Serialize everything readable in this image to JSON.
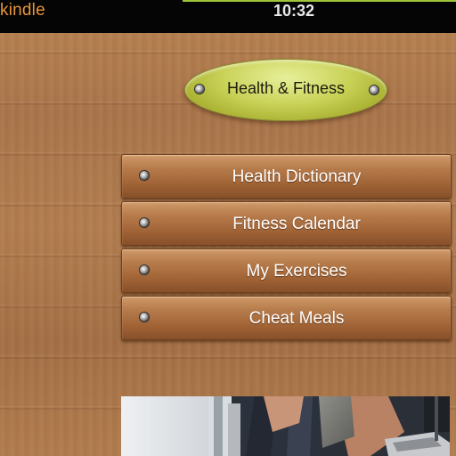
{
  "status_bar": {
    "brand": "kindle",
    "time": "10:32",
    "accent_color": "#9fc63a",
    "brand_color": "#e8943a"
  },
  "header": {
    "category": "Health & Fitness",
    "pill_color": "#c9d257"
  },
  "menu": {
    "items": [
      {
        "label": "Health Dictionary"
      },
      {
        "label": "Fitness Calendar"
      },
      {
        "label": "My Exercises"
      },
      {
        "label": "Cheat Meals"
      }
    ]
  },
  "photo": {
    "icon": "fitness-workout-photo"
  }
}
